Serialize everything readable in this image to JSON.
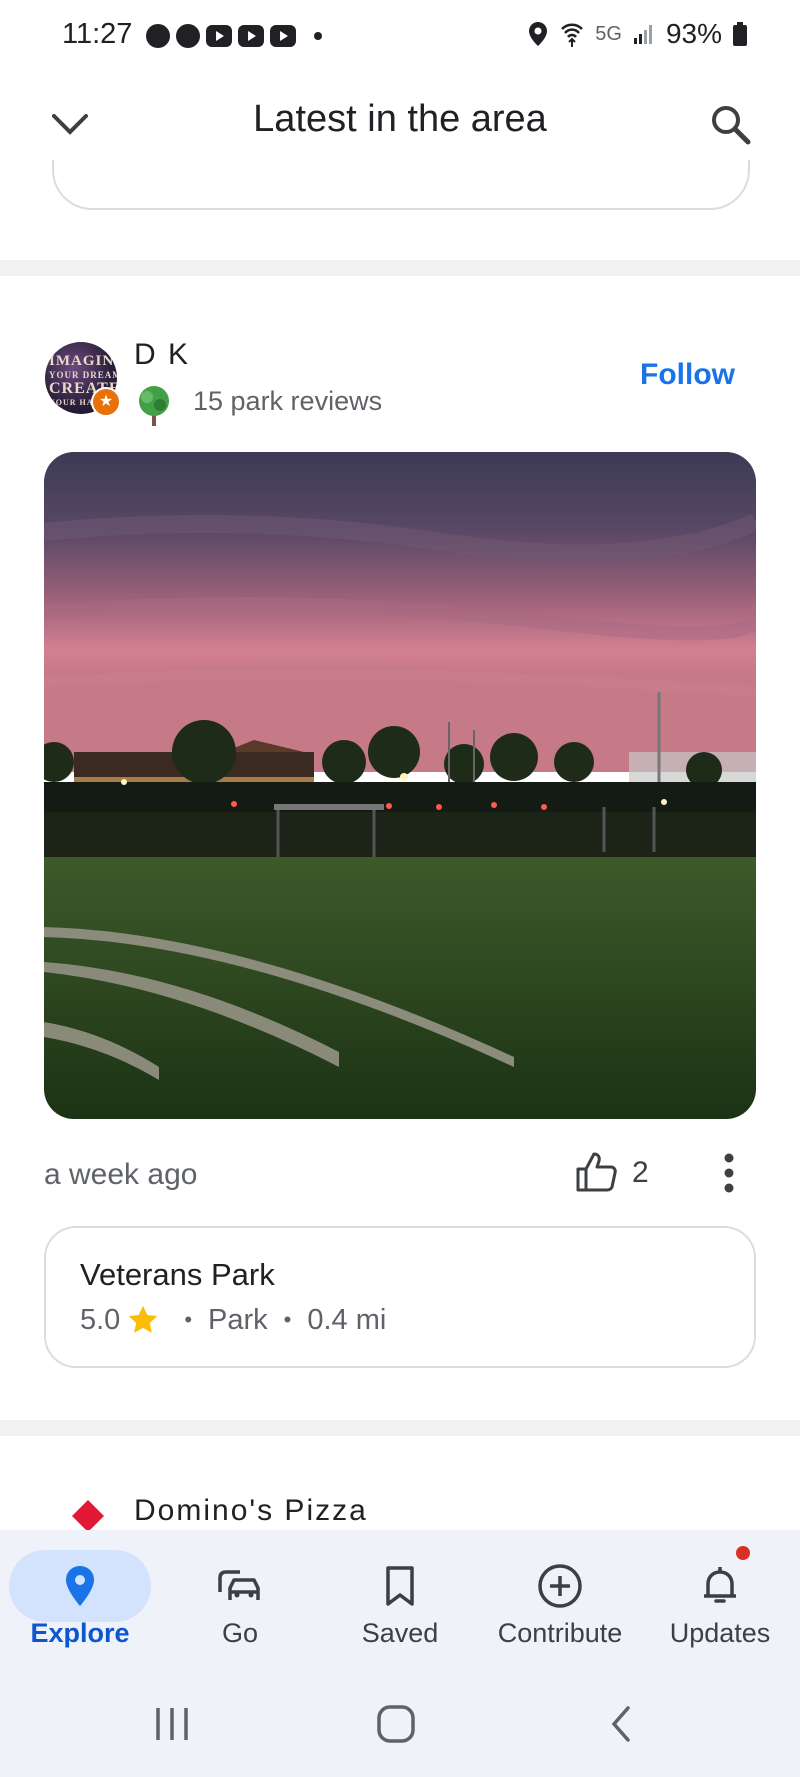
{
  "status_bar": {
    "time": "11:27",
    "network": "5G",
    "battery": "93%"
  },
  "header": {
    "title": "Latest in the area",
    "collapse_icon": "chevron-down-icon",
    "search_icon": "search-icon"
  },
  "post": {
    "author": "D K",
    "avatar_text": [
      "IMAGINE",
      "YOUR DREAM",
      "CREATE",
      "YOUR HAPP"
    ],
    "reviews": "15 park reviews",
    "follow": "Follow",
    "time_ago": "a week ago",
    "likes": "2",
    "place": {
      "name": "Veterans Park",
      "rating": "5.0",
      "category": "Park",
      "distance": "0.4 mi"
    }
  },
  "next_item": {
    "title": "Domino's Pizza"
  },
  "bottom_nav": {
    "items": [
      {
        "label": "Explore",
        "icon": "location-pin-icon",
        "active": true
      },
      {
        "label": "Go",
        "icon": "car-icon"
      },
      {
        "label": "Saved",
        "icon": "bookmark-icon"
      },
      {
        "label": "Contribute",
        "icon": "add-circle-icon"
      },
      {
        "label": "Updates",
        "icon": "bell-icon"
      }
    ]
  },
  "colors": {
    "accent": "#1a73e8",
    "active_pill": "#d3e3fd",
    "nav_bg": "#eff2f9",
    "star": "#fbbc04",
    "notification": "#d93025"
  }
}
